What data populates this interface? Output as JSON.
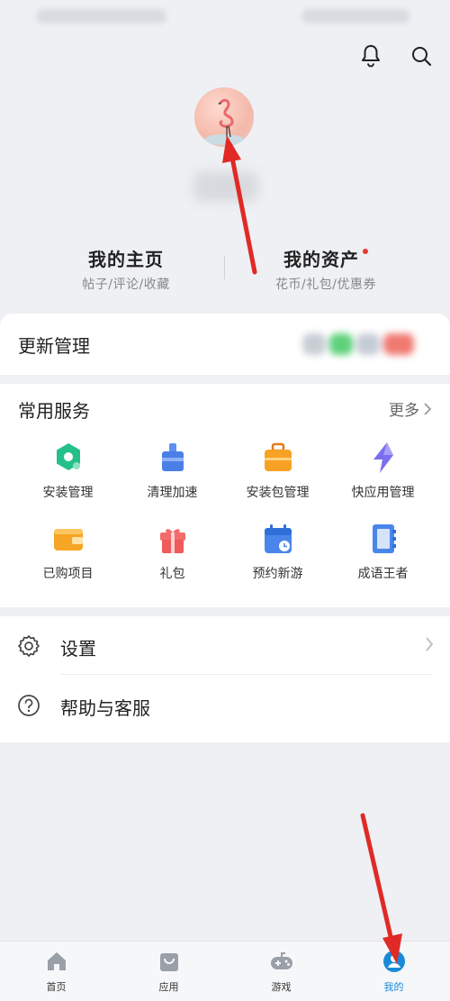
{
  "header": {
    "icons": [
      "bell-icon",
      "search-icon"
    ]
  },
  "profile": {
    "avatar_icon": "flamingo-avatar"
  },
  "stats": {
    "home": {
      "title": "我的主页",
      "sub": "帖子/评论/收藏"
    },
    "assets": {
      "title": "我的资产",
      "sub": "花币/礼包/优惠券"
    }
  },
  "update": {
    "title": "更新管理"
  },
  "services": {
    "title": "常用服务",
    "more": "更多",
    "items": [
      {
        "label": "安装管理",
        "icon": "install-manage-icon"
      },
      {
        "label": "清理加速",
        "icon": "clean-boost-icon"
      },
      {
        "label": "安装包管理",
        "icon": "package-manage-icon"
      },
      {
        "label": "快应用管理",
        "icon": "quick-app-icon"
      },
      {
        "label": "已购项目",
        "icon": "wallet-icon"
      },
      {
        "label": "礼包",
        "icon": "gift-icon"
      },
      {
        "label": "预约新游",
        "icon": "calendar-icon"
      },
      {
        "label": "成语王者",
        "icon": "book-icon"
      }
    ]
  },
  "menu": {
    "settings": "设置",
    "help": "帮助与客服"
  },
  "tabbar": {
    "home": "首页",
    "apps": "应用",
    "games": "游戏",
    "mine": "我的"
  },
  "colors": {
    "accent": "#1a8ad8",
    "dot": "#e53935",
    "annotation_arrow": "#e02a26"
  }
}
